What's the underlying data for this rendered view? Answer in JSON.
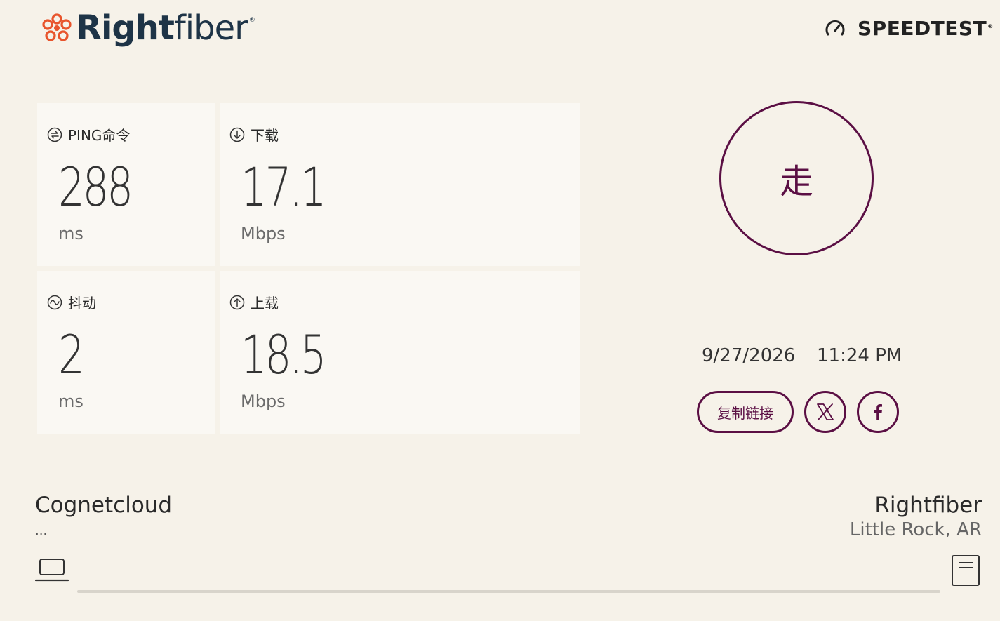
{
  "brand": {
    "logo_bold": "Right",
    "logo_light": "fiber",
    "logo_reg": "®",
    "speedtest_label": "SPEEDTEST",
    "speedtest_tm": "®"
  },
  "metrics": {
    "ping": {
      "label": "PING命令",
      "value": "288",
      "unit": "ms"
    },
    "download": {
      "label": "下载",
      "value": "17.1",
      "unit": "Mbps"
    },
    "jitter": {
      "label": "抖动",
      "value": "2",
      "unit": "ms"
    },
    "upload": {
      "label": "上载",
      "value": "18.5",
      "unit": "Mbps"
    }
  },
  "go_button": {
    "label": "走"
  },
  "result": {
    "date": "9/27/2026",
    "time": "11:24 PM"
  },
  "share": {
    "copy_link_label": "复制链接"
  },
  "connection": {
    "isp_name": "Cognetcloud",
    "isp_detail": "...",
    "server_name": "Rightfiber",
    "server_location": "Little Rock, AR"
  },
  "colors": {
    "accent": "#5b0f44",
    "background": "#f6f2e9",
    "card": "#faf8f3",
    "logo_orange": "#e8552d",
    "logo_navy": "#1e3447"
  },
  "icons": {
    "logo": "rightfiber-logo-icon",
    "speedtest": "speedometer-icon",
    "ping": "ping-icon",
    "download": "download-icon",
    "jitter": "jitter-icon",
    "upload": "upload-icon",
    "x": "x-icon",
    "facebook": "facebook-icon",
    "laptop": "laptop-icon",
    "server": "server-icon"
  }
}
